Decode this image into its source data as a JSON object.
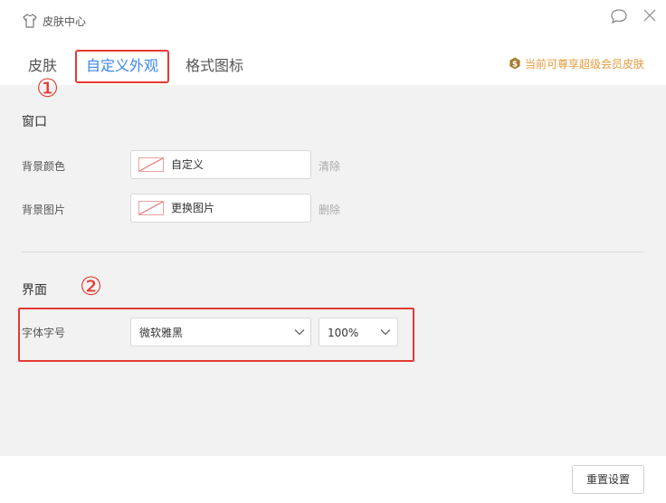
{
  "window": {
    "title": "皮肤中心",
    "title_icon": "shirt-icon",
    "feedback_icon": "chat-bubble-icon",
    "close_icon": "close-icon"
  },
  "tabs": [
    {
      "label": "皮肤",
      "active": false
    },
    {
      "label": "自定义外观",
      "active": true
    },
    {
      "label": "格式图标",
      "active": false
    }
  ],
  "vip": {
    "text": "当前可尊享超级会员皮肤",
    "icon": "vip-coin-icon",
    "color": "#e69a3d"
  },
  "window_section": {
    "title": "窗口",
    "background_color": {
      "label": "背景颜色",
      "value": "自定义",
      "action": "清除"
    },
    "background_image": {
      "label": "背景图片",
      "value": "更换图片",
      "action": "删除"
    }
  },
  "interface_section": {
    "title": "界面",
    "font": {
      "label": "字体字号",
      "family": "微软雅黑",
      "size": "100%"
    }
  },
  "annotations": {
    "first": "①",
    "second": "②",
    "color": "#e33b34"
  },
  "footer": {
    "reset_label": "重置设置"
  },
  "colors": {
    "accent": "#3b87e8",
    "content_bg": "#f2f2f2"
  }
}
